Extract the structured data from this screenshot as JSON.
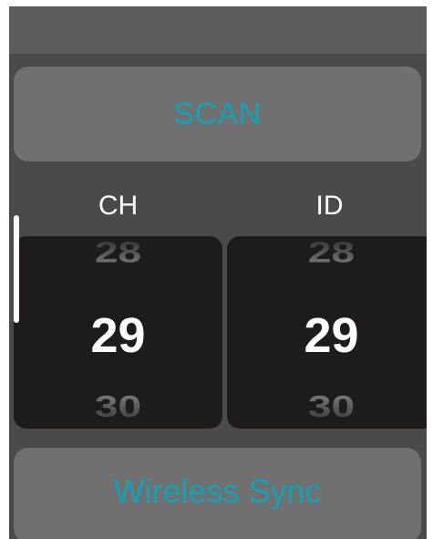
{
  "scan_button": {
    "label": "SCAN"
  },
  "pickers": {
    "ch": {
      "label": "CH",
      "prev": "28",
      "current": "29",
      "next": "30"
    },
    "id": {
      "label": "ID",
      "prev": "28",
      "current": "29",
      "next": "30"
    }
  },
  "sync_button": {
    "label": "Wireless Sync"
  },
  "colors": {
    "accent": "#14a3b6",
    "screen_background": "#4a4a4a",
    "button_background": "#707070",
    "picker_background": "#1e1b1b"
  }
}
